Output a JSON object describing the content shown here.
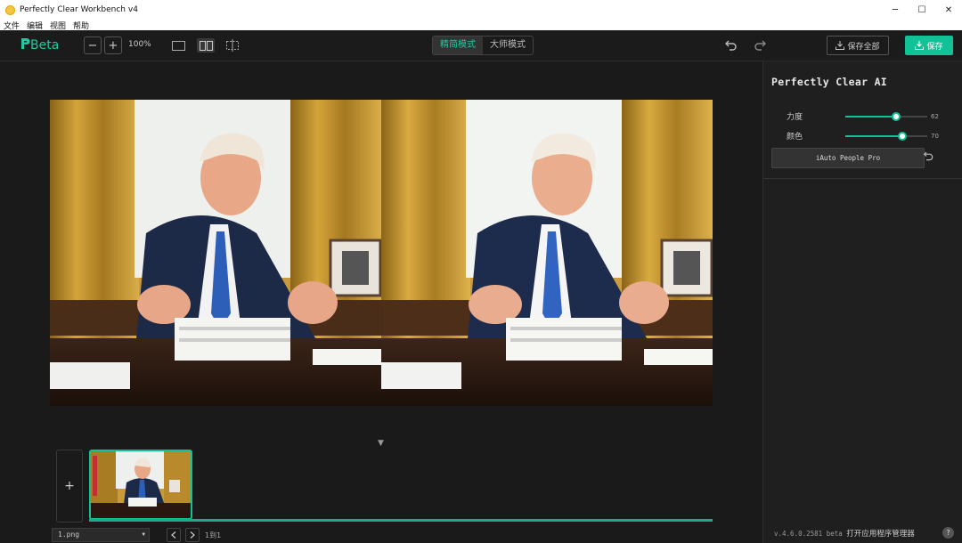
{
  "window": {
    "title": "Perfectly Clear Workbench v4"
  },
  "menu": [
    "文件",
    "编辑",
    "视图",
    "帮助"
  ],
  "toolbar": {
    "logo": "Beta",
    "zoom_out": "−",
    "zoom_in": "+",
    "zoom_level": "100%",
    "modes": [
      "精简模式",
      "大师模式"
    ],
    "active_mode": "精简模式",
    "save_all": "保存全部",
    "save": "保存"
  },
  "filmstrip": {
    "add": "+",
    "current_file": "1.png",
    "page_count": "1到1",
    "progress": 1.0
  },
  "panel": {
    "title": "Perfectly Clear AI",
    "sliders": [
      {
        "label": "力度",
        "value": 62,
        "fraction": 0.62
      },
      {
        "label": "颜色",
        "value": 70,
        "fraction": 0.7
      }
    ],
    "preset": "iAuto People Pro",
    "version": "v.4.6.0.2581 beta",
    "manager_link": "打开应用程序管理器",
    "help": "?"
  },
  "colors": {
    "accent": "#12c297",
    "background": "#1e1e1e"
  }
}
